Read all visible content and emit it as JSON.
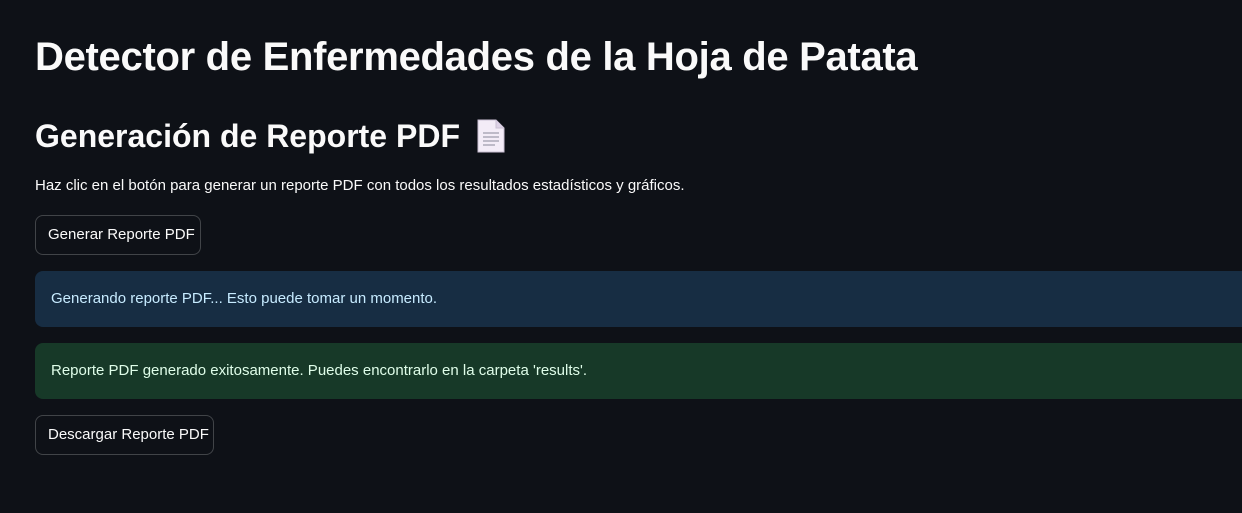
{
  "header": {
    "title": "Detector de Enfermedades de la Hoja de Patata"
  },
  "section": {
    "title": "Generación de Reporte PDF",
    "icon": "page-document-icon",
    "description": "Haz clic en el botón para generar un reporte PDF con todos los resultados estadísticos y gráficos."
  },
  "buttons": {
    "generate_label": "Generar Reporte PDF",
    "download_label": "Descargar Reporte PDF"
  },
  "alerts": {
    "info_text": "Generando reporte PDF... Esto puede tomar un momento.",
    "success_text": "Reporte PDF generado exitosamente. Puedes encontrarlo en la carpeta 'results'."
  },
  "colors": {
    "background": "#0e1117",
    "text": "#fafafa",
    "info_bg": "#172d43",
    "info_text": "#c7ebff",
    "success_bg": "#173928",
    "success_text": "#dffde9"
  }
}
